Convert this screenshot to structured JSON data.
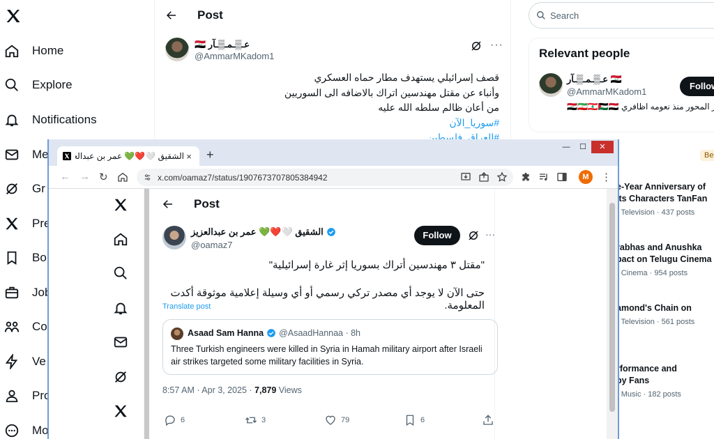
{
  "background": {
    "nav": [
      {
        "label": "Home",
        "icon": "home-icon"
      },
      {
        "label": "Explore",
        "icon": "search-icon"
      },
      {
        "label": "Notifications",
        "icon": "bell-icon"
      },
      {
        "label": "Me",
        "icon": "mail-icon"
      },
      {
        "label": "Gr",
        "icon": "grok-icon"
      },
      {
        "label": "Pre",
        "icon": "x-logo-icon"
      },
      {
        "label": "Bo",
        "icon": "bookmark-icon"
      },
      {
        "label": "Job",
        "icon": "briefcase-icon"
      },
      {
        "label": "Co",
        "icon": "communities-icon"
      },
      {
        "label": "Ve",
        "icon": "bolt-icon"
      },
      {
        "label": "Pro",
        "icon": "profile-icon"
      },
      {
        "label": "Mo",
        "icon": "more-icon"
      }
    ],
    "post_title": "Post",
    "author": {
      "name": "عـ▒ـمـ▒ـآر 🇮🇶",
      "handle": "@AmmarMKadom1"
    },
    "tweet_lines": [
      "قصف إسرائيلي يستهدف مطار حماه العسكري",
      "وأنباء عن مقتل مهندسين اتراك بالاضافه الى السوريين",
      "من أعان ظالم سلطه الله عليه"
    ],
    "tweet_tags": [
      "#سوريا_الآن",
      "#العراق_فلسطين"
    ],
    "search_placeholder": "Search",
    "relevant_people": {
      "title": "Relevant people",
      "name": "عـ▒ـمـ▒ـآر 🇮🇶",
      "handle": "@AmmarMKadom1",
      "follow": "Follow",
      "bio": "محور المحور منذ نعومه اظافري 🇮🇶🇮🇷🇱🇧🇵🇸🇾🇪"
    },
    "trend_badge": "Be",
    "trends": [
      {
        "title_1": "e-Year Anniversary of",
        "title_2": "Its Characters TanFan",
        "meta": "· Television · 437 posts"
      },
      {
        "title_1": "rabhas and Anushka",
        "title_2": "pact on Telugu Cinema",
        "meta": "· Cinema · 954 posts"
      },
      {
        "title_1": "amond's Chain on",
        "title_2": "",
        "meta": "· Television · 561 posts"
      },
      {
        "title_1": "rformance and",
        "title_2": "by Fans",
        "meta": "· Music · 182 posts"
      }
    ]
  },
  "browser": {
    "tab_title": "الشقيق 🤍❤️💚 عمر بن عبدالعزيز / X",
    "tab_close": "×",
    "new_tab": "+",
    "url": "x.com/oamaz7/status/1907673707805384942",
    "profile_initial": "M",
    "window_controls": {
      "minimize": "—",
      "maximize": "☐",
      "close": "✕"
    }
  },
  "post": {
    "title": "Post",
    "author_name": "الشقيق 🤍❤️💚 عمر بن عبدالعزيز",
    "author_handle": "@oamaz7",
    "follow_label": "Follow",
    "more": "···",
    "text_1": "\"مقتل ٣ مهندسين أتراك بسوريا إثر غارة إسرائيلية\"",
    "text_2": "حتى الآن لا يوجد أي مصدر تركي رسمي أو أي وسيلة إعلامية موثوقة أكدت المعلومة.",
    "translate": "Translate post",
    "quote": {
      "name": "Asaad Sam Hanna",
      "handle": "@AsaadHannaa · 8h",
      "body": "Three Turkish engineers were killed in Syria in Hamah military airport after Israeli air strikes targeted some military facilities in Syria."
    },
    "time": "8:57 AM · Apr 3, 2025 · ",
    "views_count": "7,879",
    "views_label": " Views",
    "actions": {
      "replies": "6",
      "reposts": "3",
      "likes": "79",
      "bookmarks": "6"
    }
  },
  "colors": {
    "accent": "#1d9bf0",
    "window_frame": "#6f9bd8",
    "close_red": "#c9302c"
  }
}
